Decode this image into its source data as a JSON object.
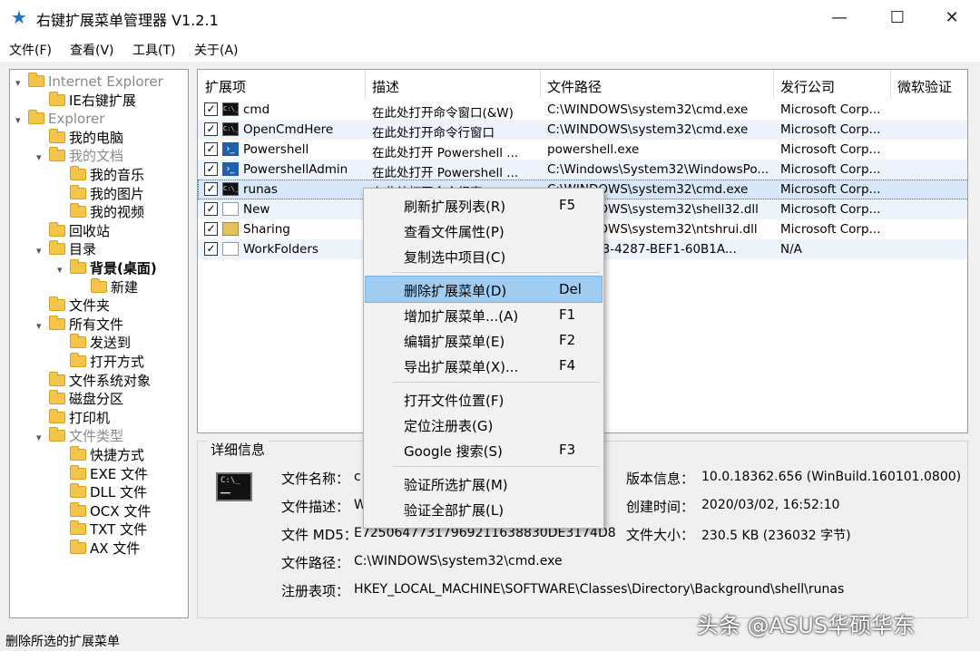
{
  "window": {
    "title": "右键扩展菜单管理器 V1.2.1",
    "minimize": "—",
    "maximize": "☐",
    "close": "✕"
  },
  "menu": [
    "文件(F)",
    "查看(V)",
    "工具(T)",
    "关于(A)"
  ],
  "tree": [
    {
      "label": "Internet Explorer",
      "gray": true,
      "expanded": true
    },
    {
      "label": "IE右键扩展"
    },
    {
      "label": "Explorer",
      "gray": true,
      "expanded": true
    },
    {
      "label": "我的电脑"
    },
    {
      "label": "我的文档",
      "gray": true,
      "expanded": true
    },
    {
      "label": "我的音乐"
    },
    {
      "label": "我的图片"
    },
    {
      "label": "我的视频"
    },
    {
      "label": "回收站"
    },
    {
      "label": "目录",
      "expanded": true
    },
    {
      "label": "背景(桌面)",
      "bold": true,
      "expanded": true
    },
    {
      "label": "新建"
    },
    {
      "label": "文件夹"
    },
    {
      "label": "所有文件",
      "expanded": true
    },
    {
      "label": "发送到"
    },
    {
      "label": "打开方式"
    },
    {
      "label": "文件系统对象"
    },
    {
      "label": "磁盘分区"
    },
    {
      "label": "打印机"
    },
    {
      "label": "文件类型",
      "gray": true,
      "expanded": true
    },
    {
      "label": "快捷方式"
    },
    {
      "label": "EXE 文件"
    },
    {
      "label": "DLL 文件"
    },
    {
      "label": "OCX 文件"
    },
    {
      "label": "TXT 文件"
    },
    {
      "label": "AX 文件"
    }
  ],
  "list": {
    "columns": [
      "扩展项",
      "描述",
      "文件路径",
      "发行公司",
      "微软验证"
    ],
    "rows": [
      {
        "name": "cmd",
        "icon": "cmd-icon",
        "desc": "在此处打开命令窗口(&W)",
        "path": "C:\\WINDOWS\\system32\\cmd.exe",
        "company": "Microsoft Corp...",
        "checked": true
      },
      {
        "name": "OpenCmdHere",
        "icon": "cmd-icon",
        "desc": "在此处打开命令行窗口",
        "path": "C:\\WINDOWS\\system32\\cmd.exe",
        "company": "Microsoft Corp...",
        "checked": true
      },
      {
        "name": "Powershell",
        "icon": "powershell-icon",
        "desc": "在此处打开 Powershell ...",
        "path": "powershell.exe",
        "company": "Microsoft Corp...",
        "checked": true
      },
      {
        "name": "PowershellAdmin",
        "icon": "powershell-icon",
        "desc": "在此处打开 Powershell ...",
        "path": "C:\\Windows\\System32\\WindowsPo...",
        "company": "Microsoft Corp...",
        "checked": true
      },
      {
        "name": "runas",
        "icon": "cmd-icon",
        "desc": "在此处打开命令行窗口(",
        "path": "C:\\WINDOWS\\system32\\cmd.exe",
        "company": "Microsoft Corp...",
        "checked": true
      },
      {
        "name": "New",
        "icon": "document-icon",
        "desc": "",
        "path": "C:\\WINDOWS\\system32\\shell32.dll",
        "company": "Microsoft Corp...",
        "checked": true
      },
      {
        "name": "Sharing",
        "icon": "sharing-icon",
        "desc": "",
        "path": "C:\\WINDOWS\\system32\\ntshrui.dll",
        "company": "Microsoft Corp...",
        "checked": true
      },
      {
        "name": "WorkFolders",
        "icon": "document-icon",
        "desc": "",
        "path": "{...8-5E63-4287-BEF1-60B1A...",
        "company": "N/A",
        "checked": true
      }
    ],
    "path_partial": {
      "runas": "WINDOWS\\system32\\cmd.exe",
      "New": "WS\\system32\\shell32.dll",
      "Sharing": "WS\\system32\\ntshrui.dll",
      "WorkFolders": "8-5E63-4287-BEF1-60B1A..."
    }
  },
  "detail": {
    "legend": "详细信息",
    "labels": {
      "name": "文件名称：",
      "desc": "文件描述：",
      "md5": "文件 MD5：",
      "path": "文件路径：",
      "reg": "注册表项：",
      "version": "版本信息：",
      "created": "创建时间：",
      "size": "文件大小："
    },
    "values": {
      "name": "c",
      "desc": "W",
      "md5": "E7250647731796921163883​0DE3174D8",
      "path": "C:\\WINDOWS\\system32\\cmd.exe",
      "reg": "HKEY_LOCAL_MACHINE\\SOFTWARE\\Classes\\Directory\\Background\\shell\\runas",
      "version": "10.0.18362.656 (WinBuild.160101.0800)",
      "created": "2020/03/02, 16:52:10",
      "size": "230.5 KB (236032 字节)"
    }
  },
  "context_menu": [
    {
      "label": "刷新扩展列表(R)",
      "key": "F5"
    },
    {
      "label": "查看文件属性(P)",
      "key": ""
    },
    {
      "label": "复制选中项目(C)",
      "key": ""
    },
    {
      "sep": true
    },
    {
      "label": "删除扩展菜单(D)",
      "key": "Del",
      "highlight": true
    },
    {
      "label": "增加扩展菜单...(A)",
      "key": "F1"
    },
    {
      "label": "编辑扩展菜单(E)",
      "key": "F2"
    },
    {
      "label": "导出扩展菜单(X)...",
      "key": "F4"
    },
    {
      "sep": true
    },
    {
      "label": "打开文件位置(F)",
      "key": ""
    },
    {
      "label": "定位注册表(G)",
      "key": ""
    },
    {
      "label": "Google 搜索(S)",
      "key": "F3"
    },
    {
      "sep": true
    },
    {
      "label": "验证所选扩展(M)",
      "key": ""
    },
    {
      "label": "验证全部扩展(L)",
      "key": ""
    }
  ],
  "status": "删除所选的扩展菜单",
  "watermark": "头条 @ASUS华硕华东"
}
